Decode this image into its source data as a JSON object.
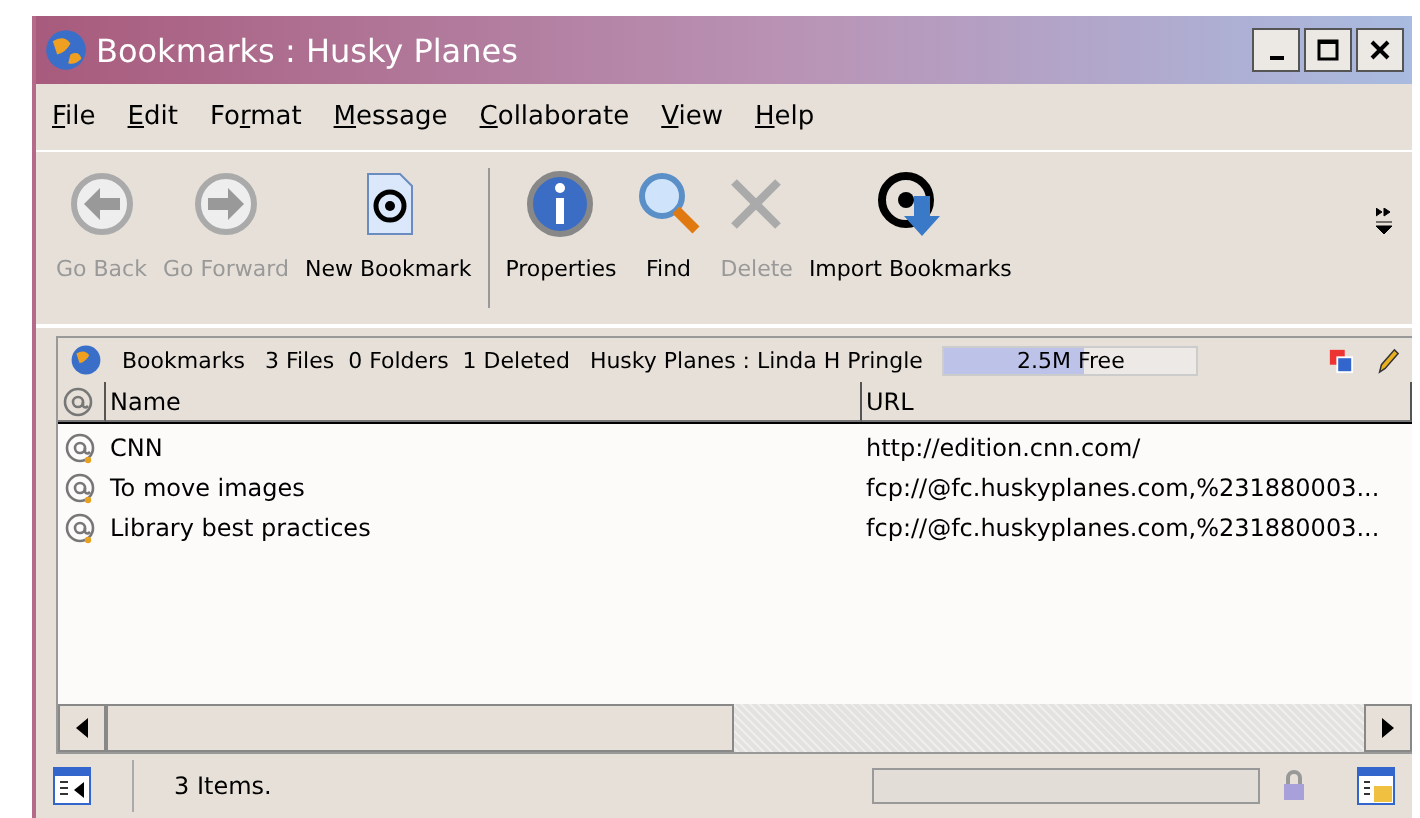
{
  "window": {
    "title": "Bookmarks : Husky Planes"
  },
  "menu": [
    {
      "key": "F",
      "after": "ile"
    },
    {
      "key": "E",
      "after": "dit"
    },
    {
      "before": "Fo",
      "key": "r",
      "after": "mat"
    },
    {
      "key": "M",
      "after": "essage"
    },
    {
      "key": "C",
      "after": "ollaborate"
    },
    {
      "key": "V",
      "after": "iew"
    },
    {
      "key": "H",
      "after": "elp"
    }
  ],
  "toolbar": [
    {
      "label": "Go Back",
      "kind": "back",
      "disabled": true
    },
    {
      "label": "Go Forward",
      "kind": "forward",
      "disabled": true
    },
    {
      "label": "New Bookmark",
      "kind": "new",
      "disabled": false
    },
    {
      "label": "Properties",
      "kind": "info",
      "disabled": false
    },
    {
      "label": "Find",
      "kind": "find",
      "disabled": false
    },
    {
      "label": "Delete",
      "kind": "delete",
      "disabled": true
    },
    {
      "label": "Import Bookmarks",
      "kind": "import",
      "disabled": false
    }
  ],
  "info_bar": {
    "title": "Bookmarks",
    "counts": "3 Files  0 Folders  1 Deleted",
    "location": "Husky Planes : Linda H Pringle",
    "free": {
      "reading": "2.5M Free",
      "level": 0.55
    }
  },
  "table": {
    "columns": [
      "Name",
      "URL"
    ],
    "rows": [
      {
        "name": "CNN",
        "url": "http://edition.cnn.com/"
      },
      {
        "name": "To move images",
        "url": "fcp://@fc.huskyplanes.com,%231880003..."
      },
      {
        "name": "Library best practices",
        "url": "fcp://@fc.huskyplanes.com,%231880003..."
      }
    ]
  },
  "status_bar": {
    "text": "3 Items."
  }
}
